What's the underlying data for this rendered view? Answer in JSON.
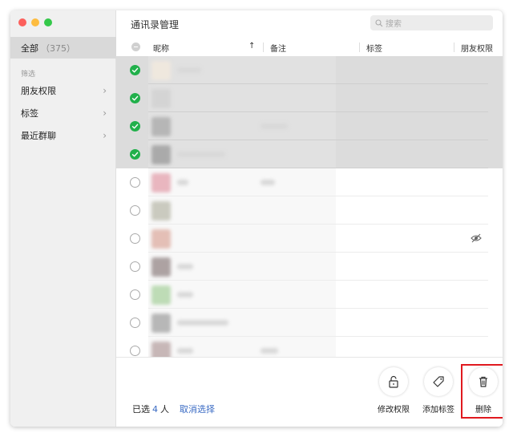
{
  "sidebar": {
    "all_label": "全部",
    "all_count": "（375）",
    "filter_label": "筛选",
    "items": [
      {
        "label": "朋友权限"
      },
      {
        "label": "标签"
      },
      {
        "label": "最近群聊"
      }
    ]
  },
  "main": {
    "title": "通讯录管理",
    "search_placeholder": "搜索",
    "columns": {
      "nickname": "昵称",
      "sort_arrow": "↑",
      "remark": "备注",
      "tag": "标签",
      "permission": "朋友权限"
    },
    "rows": [
      {
        "selected": true,
        "avatar_color": "#f1e6d8",
        "name_w": 30,
        "note_w": 0
      },
      {
        "selected": true,
        "avatar_color": "#c8c8c8",
        "name_w": 0,
        "note_w": 0
      },
      {
        "selected": true,
        "avatar_color": "#9a9a9a",
        "name_w": 0,
        "note_w": 34
      },
      {
        "selected": true,
        "avatar_color": "#888888",
        "name_w": 60,
        "note_w": 0
      },
      {
        "selected": false,
        "avatar_color": "#e89aa8",
        "name_w": 14,
        "note_w": 18
      },
      {
        "selected": false,
        "avatar_color": "#b9b9a8",
        "name_w": 0,
        "note_w": 0
      },
      {
        "selected": false,
        "avatar_color": "#e0a89a",
        "name_w": 0,
        "note_w": 0,
        "perm_icon": true
      },
      {
        "selected": false,
        "avatar_color": "#8c7c7c",
        "name_w": 20,
        "note_w": 0
      },
      {
        "selected": false,
        "avatar_color": "#a6d49a",
        "name_w": 20,
        "note_w": 0
      },
      {
        "selected": false,
        "avatar_color": "#9c9c9c",
        "name_w": 64,
        "note_w": 0
      },
      {
        "selected": false,
        "avatar_color": "#b49c9c",
        "name_w": 20,
        "note_w": 22
      }
    ]
  },
  "footer": {
    "selected_prefix": "已选",
    "selected_count": "4",
    "selected_suffix": "人",
    "cancel_selection": "取消选择",
    "actions": {
      "modify_permission": "修改权限",
      "add_tag": "添加标签",
      "delete": "删除"
    }
  },
  "colors": {
    "check_green": "#21b04b",
    "link_blue": "#3a6bc4",
    "highlight_red": "#e0191f"
  }
}
